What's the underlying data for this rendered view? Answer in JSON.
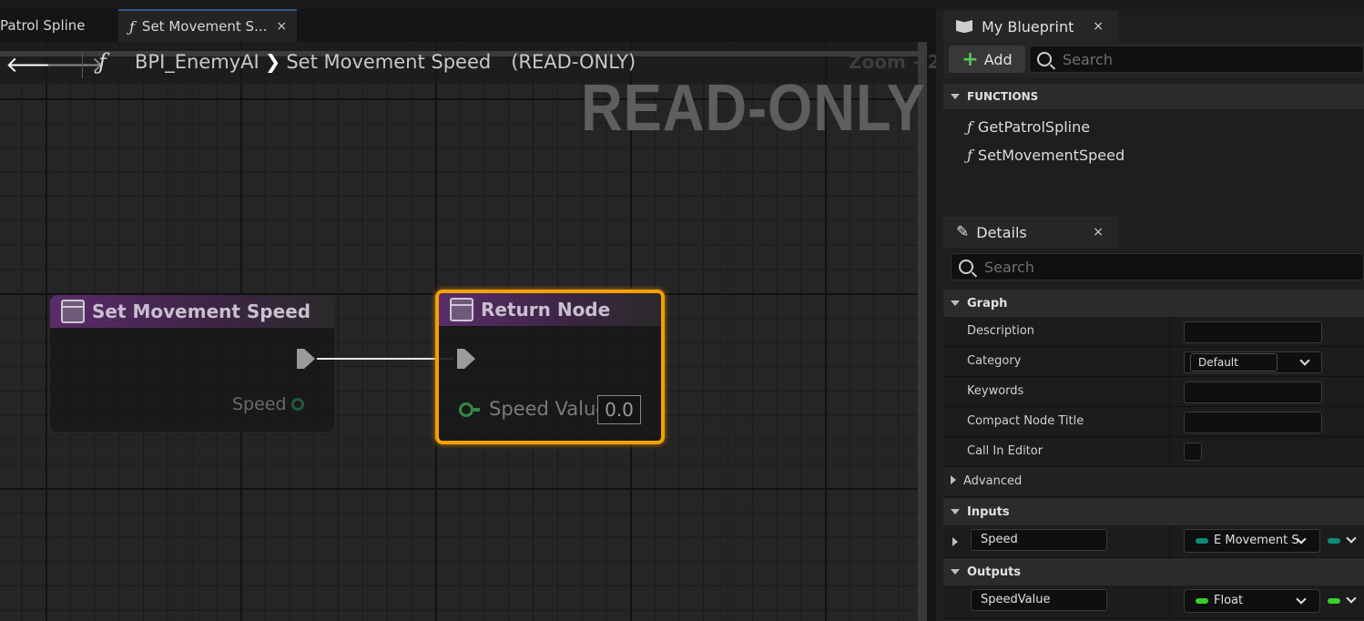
{
  "tabs": [
    {
      "label": "Patrol Spline"
    },
    {
      "label": "Set Movement S...",
      "symbol": "ƒ",
      "close": "×"
    }
  ],
  "breadcrumb": {
    "func_symbol": "ƒ",
    "path_root": "BPI_EnemyAI",
    "separator": "❯",
    "path_leaf": "Set Movement Speed",
    "mode": "(READ-ONLY)",
    "zoom": "Zoom +2",
    "watermark": "READ-ONLY"
  },
  "nav": {
    "back": "🡐",
    "forward": "🡒"
  },
  "nodes": {
    "entry": {
      "title": "Set Movement Speed",
      "pin_label": "Speed"
    },
    "return": {
      "title": "Return Node",
      "pin_label": "Speed Value",
      "pin_value": "0.0"
    }
  },
  "my_blueprint": {
    "tab_label": "My Blueprint",
    "close": "×",
    "add_label": "Add",
    "search_placeholder": "Search",
    "section": "FUNCTIONS",
    "functions": [
      "GetPatrolSpline",
      "SetMovementSpeed"
    ],
    "func_symbol": "ƒ"
  },
  "details": {
    "tab_label": "Details",
    "close": "×",
    "search_placeholder": "Search",
    "graph_section": "Graph",
    "rows": {
      "description": "Description",
      "category": "Category",
      "category_value": "Default",
      "keywords": "Keywords",
      "compact_title": "Compact Node Title",
      "call_in_editor": "Call In Editor"
    },
    "advanced": "Advanced",
    "inputs_section": "Inputs",
    "input_pin": {
      "name": "Speed",
      "type": "E Movement S",
      "color": "#0f8a78"
    },
    "outputs_section": "Outputs",
    "output_pin": {
      "name": "SpeedValue",
      "type": "Float",
      "color": "#39d02a"
    }
  }
}
